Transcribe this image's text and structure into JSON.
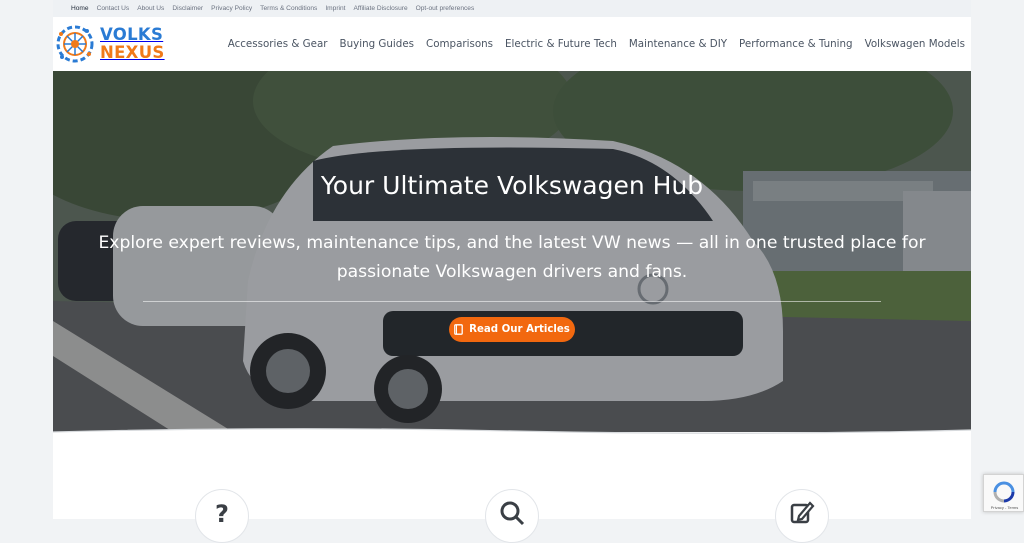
{
  "topbar": {
    "links": [
      "Home",
      "Contact Us",
      "About Us",
      "Disclaimer",
      "Privacy Policy",
      "Terms & Conditions",
      "Imprint",
      "Affiliate Disclosure",
      "Opt-out preferences"
    ]
  },
  "logo": {
    "line1": "VOLKS",
    "line2": "NEXUS",
    "icon": "gear-circuit-logo"
  },
  "nav": {
    "items": [
      "Accessories & Gear",
      "Buying Guides",
      "Comparisons",
      "Electric & Future Tech",
      "Maintenance & DIY",
      "Performance & Tuning",
      "Volkswagen Models"
    ]
  },
  "hero": {
    "title": "Your Ultimate Volkswagen Hub",
    "subtitle_line1": "Explore expert reviews, maintenance tips, and the latest VW news — all in one trusted place for",
    "subtitle_line2": "passionate Volkswagen drivers and fans.",
    "button_label": "Read Our Articles",
    "button_icon": "book-icon"
  },
  "features": {
    "icons": [
      {
        "name": "question-icon",
        "glyph": "?"
      },
      {
        "name": "search-icon",
        "glyph": ""
      },
      {
        "name": "edit-icon",
        "glyph": ""
      }
    ]
  },
  "recaptcha": {
    "footer": "Privacy - Terms"
  },
  "colors": {
    "brand_blue": "#2a7bd4",
    "brand_orange": "#f07a1a",
    "cta": "#f2680f"
  }
}
